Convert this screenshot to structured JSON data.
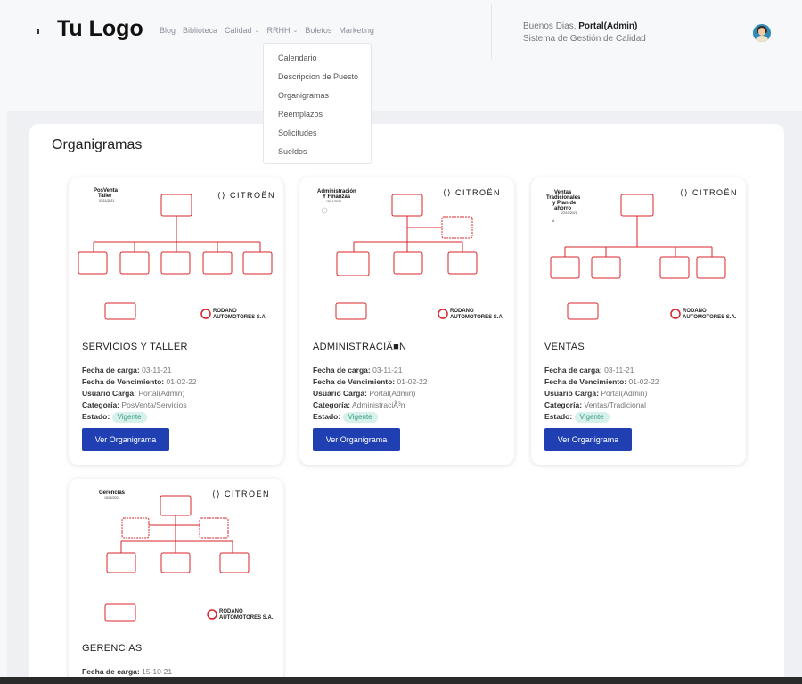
{
  "header": {
    "logo": "Tu Logo",
    "nav": [
      {
        "label": "Blog",
        "dropdown": false
      },
      {
        "label": "Biblioteca",
        "dropdown": false
      },
      {
        "label": "Calidad",
        "dropdown": true
      },
      {
        "label": "RRHH",
        "dropdown": true
      },
      {
        "label": "Boletos",
        "dropdown": false
      },
      {
        "label": "Marketing",
        "dropdown": false
      }
    ],
    "greeting_prefix": "Buenos Dias,",
    "user_name": "Portal(Admin)",
    "subtitle": "Sistema de Gestión de Calidad"
  },
  "dropdown": {
    "items": [
      "Calendario",
      "Descripcion de Puesto",
      "Organigramas",
      "Reemplazos",
      "Solicitudes",
      "Sueldos"
    ]
  },
  "main": {
    "title": "Organigramas",
    "labels": {
      "fecha_carga": "Fecha de carga:",
      "fecha_vencimiento": "Fecha de Vencimiento:",
      "usuario": "Usuario Carga:",
      "categoria": "Categoría:",
      "estado": "Estado:"
    },
    "button_label": "Ver Organigrama",
    "brand": "CITROËN",
    "company_line1": "RODANO",
    "company_line2": "AUTOMOTORES S.A.",
    "cards": [
      {
        "title": "SERVICIOS Y TALLER",
        "fecha_carga": "03-11-21",
        "fecha_vencimiento": "01-02-22",
        "usuario": "Portal(Admin)",
        "categoria": "PosVenta/Servicios",
        "estado": "Vigente",
        "chart_title": "PosVenta\nTaller"
      },
      {
        "title": "ADMINISTRACIÃ■N",
        "fecha_carga": "03-11-21",
        "fecha_vencimiento": "01-02-22",
        "usuario": "Portal(Admin)",
        "categoria": "AdministraciÃ³n",
        "estado": "Vigente",
        "chart_title": "Administración\nY Finanzas"
      },
      {
        "title": "VENTAS",
        "fecha_carga": "03-11-21",
        "fecha_vencimiento": "01-02-22",
        "usuario": "Portal(Admin)",
        "categoria": "Ventas/Tradicional",
        "estado": "Vigente",
        "chart_title": "Ventas\nTradicionales\ny Plan de\nahorro"
      },
      {
        "title": "GERENCIAS",
        "fecha_carga": "15-10-21",
        "chart_title": "Gerencias"
      }
    ]
  },
  "colors": {
    "accent": "#1f3fb3",
    "badge_bg": "#d5f1ea",
    "badge_text": "#3a9a84",
    "org_red": "#d8232a"
  }
}
